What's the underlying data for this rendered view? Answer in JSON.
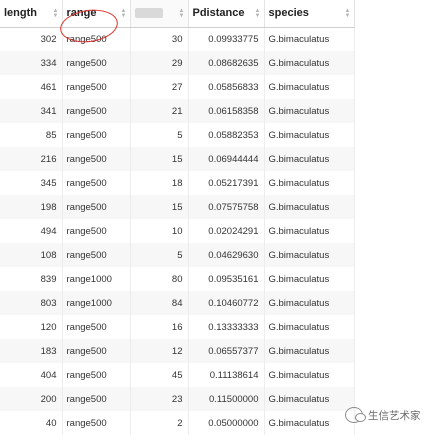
{
  "table": {
    "columns": [
      {
        "label": "length"
      },
      {
        "label": "range"
      },
      {
        "label": ""
      },
      {
        "label": "Pdistance"
      },
      {
        "label": "species"
      }
    ],
    "rows": [
      [
        "302",
        "range500",
        "30",
        "0.09933775",
        "G.bimaculatus"
      ],
      [
        "334",
        "range500",
        "29",
        "0.08682635",
        "G.bimaculatus"
      ],
      [
        "461",
        "range500",
        "27",
        "0.05856833",
        "G.bimaculatus"
      ],
      [
        "341",
        "range500",
        "21",
        "0.06158358",
        "G.bimaculatus"
      ],
      [
        "85",
        "range500",
        "5",
        "0.05882353",
        "G.bimaculatus"
      ],
      [
        "216",
        "range500",
        "15",
        "0.06944444",
        "G.bimaculatus"
      ],
      [
        "345",
        "range500",
        "18",
        "0.05217391",
        "G.bimaculatus"
      ],
      [
        "198",
        "range500",
        "15",
        "0.07575758",
        "G.bimaculatus"
      ],
      [
        "494",
        "range500",
        "10",
        "0.02024291",
        "G.bimaculatus"
      ],
      [
        "108",
        "range500",
        "5",
        "0.04629630",
        "G.bimaculatus"
      ],
      [
        "839",
        "range1000",
        "80",
        "0.09535161",
        "G.bimaculatus"
      ],
      [
        "803",
        "range1000",
        "84",
        "0.10460772",
        "G.bimaculatus"
      ],
      [
        "120",
        "range500",
        "16",
        "0.13333333",
        "G.bimaculatus"
      ],
      [
        "183",
        "range500",
        "12",
        "0.06557377",
        "G.bimaculatus"
      ],
      [
        "404",
        "range500",
        "45",
        "0.11138614",
        "G.bimaculatus"
      ],
      [
        "200",
        "range500",
        "23",
        "0.11500000",
        "G.bimaculatus"
      ],
      [
        "40",
        "range500",
        "2",
        "0.05000000",
        "G.bimaculatus"
      ]
    ]
  },
  "watermark": {
    "text": "生信艺术家",
    "icon": "wechat-icon"
  },
  "colors": {
    "annotation_circle": "#e0302a",
    "stripe": "#f7f7f7"
  }
}
